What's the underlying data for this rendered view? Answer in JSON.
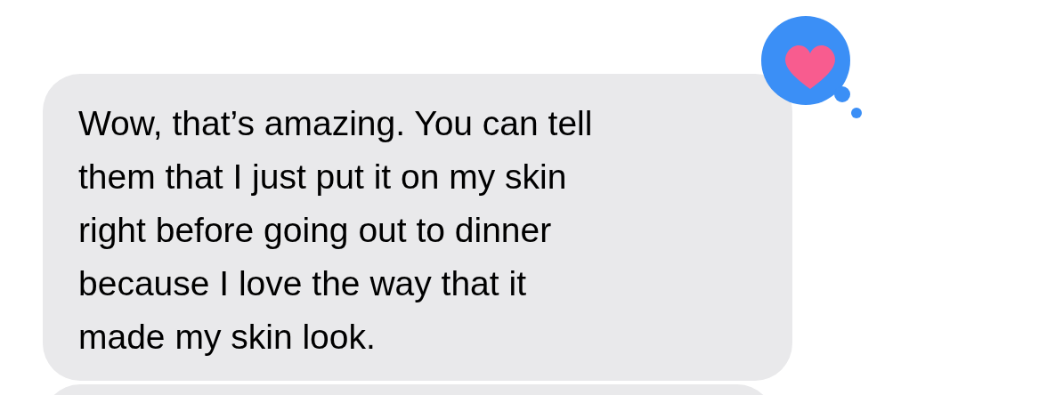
{
  "messages": [
    {
      "kind": "received",
      "text": "Wow, that’s amazing. You can tell\nthem that I just put it on my skin\nright before going out to dinner\nbecause I love the way that it\nmade my skin look.",
      "reaction": {
        "kind": "heart"
      }
    },
    {
      "kind": "cut_off"
    }
  ]
}
